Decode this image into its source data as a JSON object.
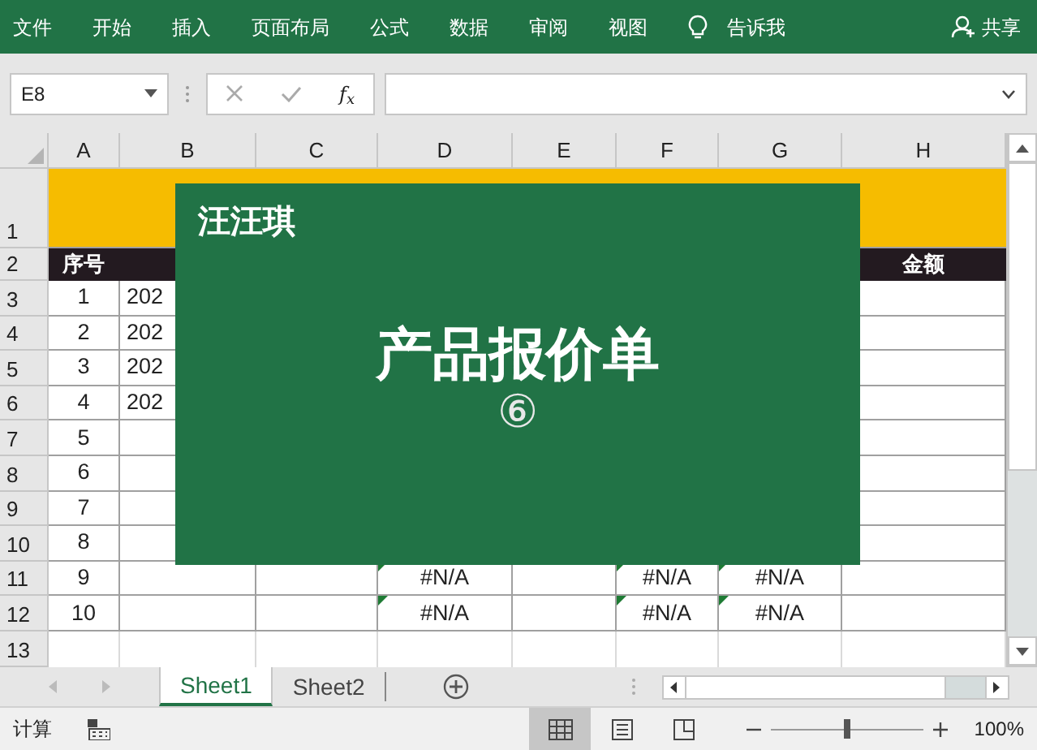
{
  "ribbon": {
    "tabs": [
      {
        "label": "文件"
      },
      {
        "label": "开始"
      },
      {
        "label": "插入"
      },
      {
        "label": "页面布局"
      },
      {
        "label": "公式"
      },
      {
        "label": "数据"
      },
      {
        "label": "审阅"
      },
      {
        "label": "视图"
      }
    ],
    "tell_me": "告诉我",
    "share": "共享"
  },
  "formula_bar": {
    "name_box": "E8",
    "fx": "f$_{x}$"
  },
  "columns": [
    "A",
    "B",
    "C",
    "D",
    "E",
    "F",
    "G",
    "H"
  ],
  "rows": [
    {
      "number": "1",
      "kind": "title",
      "cells": []
    },
    {
      "number": "2",
      "kind": "header",
      "cells": [
        "序号",
        "",
        "",
        "",
        "",
        "",
        "",
        "金额"
      ]
    },
    {
      "number": "3",
      "kind": "data",
      "cells": [
        "1",
        "202",
        "",
        "",
        "",
        "",
        "",
        ""
      ]
    },
    {
      "number": "4",
      "kind": "data",
      "cells": [
        "2",
        "202",
        "",
        "",
        "",
        "",
        "",
        ""
      ]
    },
    {
      "number": "5",
      "kind": "data",
      "cells": [
        "3",
        "202",
        "",
        "",
        "",
        "",
        "",
        ""
      ]
    },
    {
      "number": "6",
      "kind": "data",
      "cells": [
        "4",
        "202",
        "",
        "",
        "",
        "",
        "",
        ""
      ]
    },
    {
      "number": "7",
      "kind": "data",
      "cells": [
        "5",
        "",
        "",
        "",
        "",
        "",
        "",
        ""
      ]
    },
    {
      "number": "8",
      "kind": "data",
      "cells": [
        "6",
        "",
        "",
        "",
        "",
        "",
        "",
        ""
      ]
    },
    {
      "number": "9",
      "kind": "data",
      "cells": [
        "7",
        "",
        "",
        "",
        "",
        "",
        "",
        ""
      ]
    },
    {
      "number": "10",
      "kind": "data",
      "cells": [
        "8",
        "",
        "",
        "",
        "",
        "",
        "",
        ""
      ]
    },
    {
      "number": "11",
      "kind": "data",
      "cells": [
        "9",
        "",
        "",
        {
          "text": "#N/A",
          "error": true
        },
        "",
        {
          "text": "#N/A",
          "error": true
        },
        {
          "text": "#N/A",
          "error": true
        },
        ""
      ]
    },
    {
      "number": "12",
      "kind": "data",
      "cells": [
        "10",
        "",
        "",
        {
          "text": "#N/A",
          "error": true
        },
        "",
        {
          "text": "#N/A",
          "error": true
        },
        {
          "text": "#N/A",
          "error": true
        },
        ""
      ]
    },
    {
      "number": "13",
      "kind": "blank",
      "cells": []
    }
  ],
  "overlay": {
    "brand": "汪汪琪",
    "title": "产品报价单",
    "number": "⑥"
  },
  "sheet_tabs": [
    {
      "label": "Sheet1",
      "selected": true
    },
    {
      "label": "Sheet2",
      "selected": false
    }
  ],
  "status_bar": {
    "mode": "计算",
    "views": [
      {
        "kind": "normal",
        "selected": true
      },
      {
        "kind": "page_layout",
        "selected": false
      },
      {
        "kind": "page_break",
        "selected": false
      }
    ],
    "zoom": {
      "level": 0.5,
      "reading": "100%"
    }
  }
}
